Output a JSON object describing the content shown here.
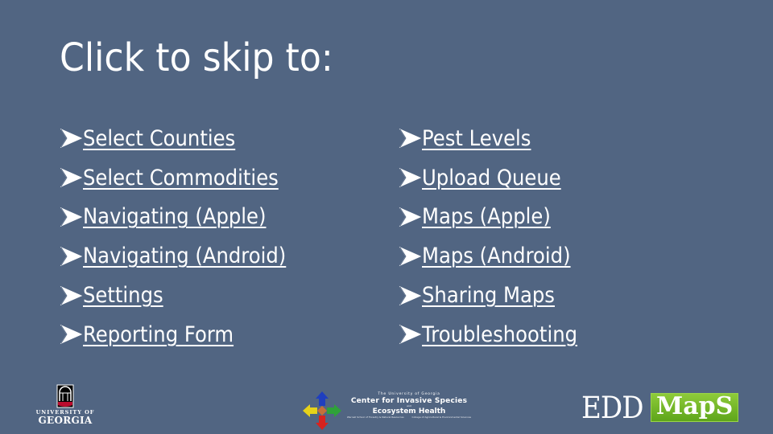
{
  "slide": {
    "title": "Click to skip to:",
    "background_color": "#516582",
    "bullet_icon": "arrowhead-bullet"
  },
  "links": {
    "left": [
      {
        "label": "Select Counties"
      },
      {
        "label": "Select Commodities"
      },
      {
        "label": "Navigating (Apple)"
      },
      {
        "label": "Navigating (Android)"
      },
      {
        "label": "Settings"
      },
      {
        "label": "Reporting Form"
      }
    ],
    "right": [
      {
        "label": "Pest Levels"
      },
      {
        "label": "Upload Queue"
      },
      {
        "label": "Maps (Apple)"
      },
      {
        "label": "Maps (Android)"
      },
      {
        "label": "Sharing Maps"
      },
      {
        "label": "Troubleshooting"
      }
    ]
  },
  "logos": {
    "uga": {
      "line1": "UNIVERSITY OF",
      "line2": "GEORGIA",
      "accent": "#ba0c2f"
    },
    "cise": {
      "line1": "The University of Georgia",
      "line2": "Center for Invasive Species",
      "line3": "and",
      "line4": "Ecosystem Health",
      "sub_left": "Warnell School of Forestry & Natural Resources",
      "sub_right": "College of Agricultural & Environmental Sciences"
    },
    "eddmaps": {
      "part1": "EDD",
      "part2": "MapS",
      "accent": "#6fb826"
    }
  }
}
